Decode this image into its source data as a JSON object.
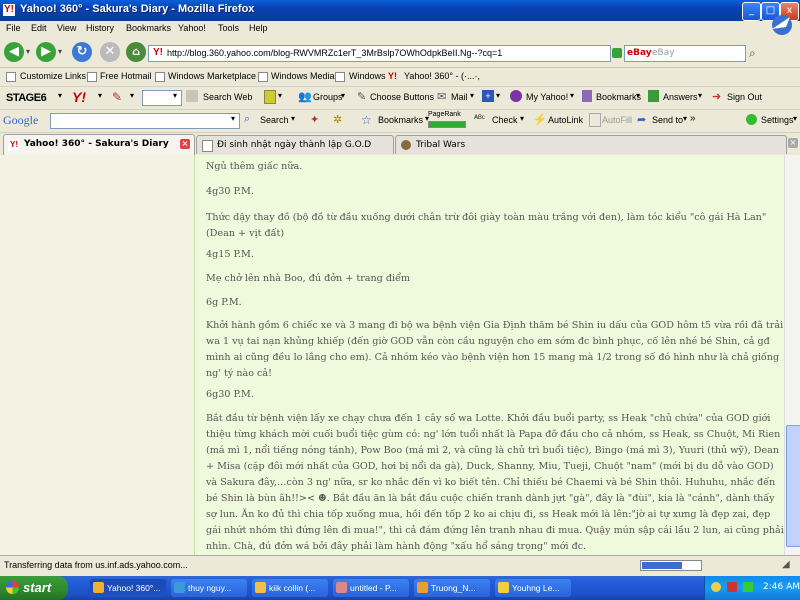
{
  "window": {
    "title": "Yahoo! 360° - Sakura's Diary - Mozilla Firefox",
    "favicon_text": "Y!",
    "controls": {
      "minimize": "_",
      "maximize": "□",
      "close": "x"
    }
  },
  "menu": [
    "File",
    "Edit",
    "View",
    "History",
    "Bookmarks",
    "Yahoo!",
    "Tools",
    "Help"
  ],
  "nav": {
    "url": "http://blog.360.yahoo.com/blog-RWVMRZc1erT_3MrBslp7OWhOdpkBeII.Ng--?cq=1",
    "search_engine_label": "eBay",
    "search_placeholder": "eBay"
  },
  "bookmarks_bar": [
    "Customize Links",
    "Free Hotmail",
    "Windows Marketplace",
    "Windows Media",
    "Windows",
    "Yahoo! 360° - (·...·,"
  ],
  "stage_toolbar": {
    "brand": "STAGE6",
    "yahoo": "Y!",
    "search_web": "Search Web",
    "groups": "Groups",
    "choose_buttons": "Choose Buttons",
    "mail": "Mail",
    "my_yahoo": "My Yahoo!",
    "bookmarks": "Bookmarks",
    "answers": "Answers",
    "sign_out": "Sign Out"
  },
  "google_toolbar": {
    "brand": "Google",
    "search": "Search",
    "bookmarks": "Bookmarks",
    "pagerank": "PageRank",
    "check": "Check",
    "autolink": "AutoLink",
    "autofill": "AutoFill",
    "send_to": "Send to",
    "settings": "Settings"
  },
  "tabs": [
    {
      "label": "Yahoo! 360° - Sakura's Diary",
      "active": true
    },
    {
      "label": "Đi sinh nhật ngày thành lập G.O.D",
      "active": false
    },
    {
      "label": "Tribal Wars",
      "active": false
    }
  ],
  "article": [
    "Ngủ thêm giấc nữa.",
    "4g30 P.M.",
    "Thức dậy thay đồ (bộ đồ từ đầu xuống dưới chân trừ đôi giày toàn màu trắng với đen), làm tóc kiểu \"cô gái Hà Lan\" (Dean + vịt đất)",
    "4g15 P.M.",
    "Mẹ chở lên nhà Boo, đú đởn + trang điểm",
    "6g P.M.",
    "Khởi hành gồm 6 chiếc xe và 3 mang đi bộ wa bệnh viện Gia Định thăm bé Shin iu dấu của GOD hôm t5 vừa rồi đã trải wa 1 vụ tai nạn khủng khiếp (đến giờ GOD vẫn còn cầu nguyện cho em sớm đc bình phục, cố lên nhé bé Shin, cả gđ mình ai cũng đều lo lắng cho em). Cả nhóm kéo vào bệnh viện hơn 15 mang mà 1/2 trong số đó hình như là chả giống ng' tý nào cả!",
    "6g30 P.M.",
    "Bắt đầu từ bệnh viện lấy xe chạy chưa đến 1 cây số wa Lotte. Khởi đầu buổi party, ss Heak \"chủ chứa\" của GOD giới thiệu từng khách mời cuối buổi tiệc gùm có: ng' lớn tuổi nhất là Papa đỡ đầu cho cả nhóm, ss Heak, ss Chuột, Mi Rien (má mì 1, nổi tiếng nóng tánh), Pow Boo (má mì 2, và cũng là chủ trì buổi tiệc), Bingo (má mì 3), Yuuri (thủ wỹ), Dean + Misa (cặp đôi mới nhất của GOD, hơi bị nổi da gà), Duck, Shanny, Miu, Tueji, Chuột \"nam\" (mới bị du dỗ vào GOD) và Sakura đây,…còn 3 ng' nữa, sr ko nhắc đến vì ko biết tên. Chỉ thiếu bé Chaemi và bé Shin thôi. Huhuhu, nhắc đến bé Shin là bùn ãh!!>< ☻. Bắt đầu ăn là bắt đầu cuộc chiến tranh dành jựt \"gà\", đây là \"đùi\", kia là \"cánh\", dành thấy sợ lun. Ăn ko đủ thì chia tốp xuống mua, hồi đến tốp 2 ko ai chịu đi, ss Heak mới là lên:\"jờ ai tự xưng là đẹp zai, đẹp gái nhứt nhóm thì đứng lên đi mua!\", thì cả đám đứng lên tranh nhau đi mua. Quậy mún sập cái lầu 2 lun, ai cũng phải nhìn. Chà, đú đởn wá bởi đây phải làm hành động \"xấu hổ sáng trọng\" mới đc."
  ],
  "status": "Transferring data from us.inf.ads.yahoo.com...",
  "taskbar": {
    "start": "start",
    "tasks": [
      {
        "label": "Yahoo! 360°...",
        "active": true
      },
      {
        "label": "thuy nguy...",
        "active": false
      },
      {
        "label": "kiik collin (...",
        "active": false
      },
      {
        "label": "untitled - P...",
        "active": false
      },
      {
        "label": "Truong_N...",
        "active": false
      },
      {
        "label": "Youhng Le...",
        "active": false
      }
    ],
    "clock": "2:46 AM"
  }
}
